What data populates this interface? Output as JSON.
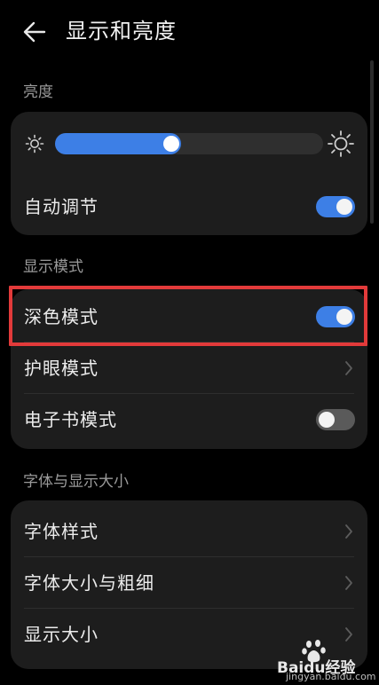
{
  "header": {
    "title": "显示和亮度"
  },
  "brightness": {
    "section_label": "亮度",
    "level": 0.47,
    "auto_adjust": {
      "label": "自动调节",
      "on": true
    }
  },
  "display_mode": {
    "section_label": "显示模式",
    "items": [
      {
        "label": "深色模式",
        "control": "toggle",
        "on": true
      },
      {
        "label": "护眼模式",
        "control": "chevron"
      },
      {
        "label": "电子书模式",
        "control": "toggle",
        "on": false
      }
    ]
  },
  "font_size": {
    "section_label": "字体与显示大小",
    "items": [
      {
        "label": "字体样式"
      },
      {
        "label": "字体大小与粗细"
      },
      {
        "label": "显示大小"
      }
    ]
  },
  "colors": {
    "accent": "#3d7fe6",
    "card": "#1d1d1d",
    "highlight": "#e23a3a"
  },
  "icons": [
    "back-arrow-icon",
    "brightness-low-icon",
    "brightness-high-icon",
    "chevron-right-icon"
  ],
  "watermark": {
    "text": "Baidu经验",
    "url": "jingyan.baidu.com"
  }
}
